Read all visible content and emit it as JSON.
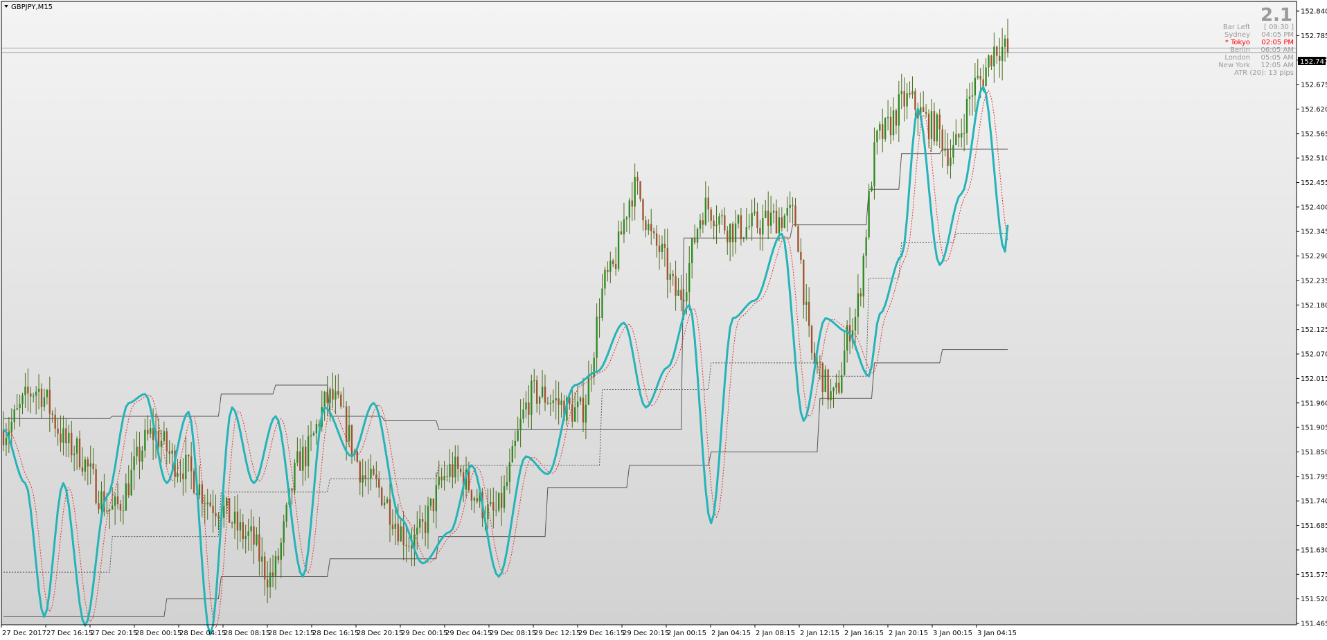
{
  "window_title": "GBPJPY,M15",
  "info_panel": {
    "big_number": "2.1",
    "rows": [
      {
        "label": "Bar Left",
        "value": "[ 09:30 ]",
        "highlight": false
      },
      {
        "label": "Sydney",
        "value": "04:05 PM",
        "highlight": false
      },
      {
        "label": "* Tokyo",
        "value": "02:05 PM",
        "highlight": true
      },
      {
        "label": "Berlin",
        "value": "06:05 AM",
        "highlight": false
      },
      {
        "label": "London",
        "value": "05:05 AM",
        "highlight": false
      },
      {
        "label": "New York",
        "value": "12:05 AM",
        "highlight": false
      }
    ],
    "atr": "ATR (20): 13 pips"
  },
  "price_label": "152.747",
  "colors": {
    "bull": "#2e8b22",
    "bear": "#a0522d",
    "osc": "#26b3b8",
    "signal": "#e03030",
    "level": "#555555",
    "highlight": "#ff0000"
  },
  "chart_data": {
    "type": "candlestick",
    "symbol": "GBPJPY",
    "timeframe": "M15",
    "ylim": [
      151.465,
      152.84
    ],
    "y_ticks": [
      "152.840",
      "152.785",
      "152.730",
      "152.675",
      "152.620",
      "152.565",
      "152.510",
      "152.455",
      "152.400",
      "152.345",
      "152.290",
      "152.235",
      "152.180",
      "152.125",
      "152.070",
      "152.015",
      "151.960",
      "151.905",
      "151.850",
      "151.795",
      "151.740",
      "151.685",
      "151.630",
      "151.575",
      "151.520",
      "151.465"
    ],
    "x_ticks": [
      "27 Dec 2017",
      "27 Dec 16:15",
      "27 Dec 20:15",
      "28 Dec 00:15",
      "28 Dec 04:15",
      "28 Dec 08:15",
      "28 Dec 12:15",
      "28 Dec 16:15",
      "28 Dec 20:15",
      "29 Dec 00:15",
      "29 Dec 04:15",
      "29 Dec 08:15",
      "29 Dec 12:15",
      "29 Dec 16:15",
      "29 Dec 20:15",
      "2 Jan 00:15",
      "2 Jan 04:15",
      "2 Jan 08:15",
      "2 Jan 12:15",
      "2 Jan 16:15",
      "2 Jan 20:15",
      "3 Jan 00:15",
      "3 Jan 04:15"
    ],
    "bar_count": 370,
    "current_price": 152.747,
    "horizontal_lines": [
      152.757,
      152.747
    ],
    "price_path": [
      [
        0,
        151.9
      ],
      [
        12,
        151.99
      ],
      [
        25,
        151.86
      ],
      [
        40,
        151.72
      ],
      [
        55,
        151.89
      ],
      [
        65,
        151.82
      ],
      [
        78,
        151.73
      ],
      [
        90,
        151.66
      ],
      [
        98,
        151.57
      ],
      [
        110,
        151.84
      ],
      [
        120,
        151.97
      ],
      [
        135,
        151.78
      ],
      [
        150,
        151.65
      ],
      [
        165,
        151.81
      ],
      [
        180,
        151.71
      ],
      [
        195,
        151.98
      ],
      [
        212,
        151.94
      ],
      [
        222,
        152.24
      ],
      [
        232,
        152.44
      ],
      [
        240,
        152.31
      ],
      [
        248,
        152.2
      ],
      [
        258,
        152.4
      ],
      [
        268,
        152.35
      ],
      [
        290,
        152.38
      ],
      [
        298,
        152.05
      ],
      [
        305,
        151.97
      ],
      [
        312,
        152.14
      ],
      [
        322,
        152.56
      ],
      [
        332,
        152.64
      ],
      [
        342,
        152.58
      ],
      [
        348,
        152.52
      ],
      [
        358,
        152.68
      ],
      [
        365,
        152.76
      ],
      [
        370,
        152.75
      ]
    ],
    "oscillator_path": [
      [
        0,
        151.9
      ],
      [
        8,
        151.78
      ],
      [
        15,
        151.48
      ],
      [
        22,
        151.78
      ],
      [
        30,
        151.46
      ],
      [
        38,
        151.75
      ],
      [
        46,
        151.96
      ],
      [
        52,
        151.98
      ],
      [
        60,
        151.78
      ],
      [
        68,
        151.94
      ],
      [
        76,
        151.44
      ],
      [
        84,
        151.95
      ],
      [
        92,
        151.78
      ],
      [
        100,
        151.93
      ],
      [
        110,
        151.57
      ],
      [
        118,
        151.95
      ],
      [
        128,
        151.84
      ],
      [
        136,
        151.96
      ],
      [
        146,
        151.7
      ],
      [
        154,
        151.6
      ],
      [
        164,
        151.67
      ],
      [
        172,
        151.82
      ],
      [
        182,
        151.57
      ],
      [
        192,
        151.84
      ],
      [
        200,
        151.8
      ],
      [
        210,
        152.0
      ],
      [
        218,
        152.03
      ],
      [
        228,
        152.14
      ],
      [
        236,
        151.95
      ],
      [
        244,
        152.04
      ],
      [
        252,
        152.18
      ],
      [
        260,
        151.69
      ],
      [
        268,
        152.15
      ],
      [
        276,
        152.19
      ],
      [
        286,
        152.34
      ],
      [
        294,
        151.92
      ],
      [
        302,
        152.15
      ],
      [
        310,
        152.12
      ],
      [
        318,
        152.02
      ],
      [
        322,
        152.16
      ],
      [
        330,
        152.29
      ],
      [
        336,
        152.62
      ],
      [
        344,
        152.27
      ],
      [
        352,
        152.43
      ],
      [
        360,
        152.67
      ],
      [
        368,
        152.3
      ],
      [
        370,
        152.42
      ]
    ],
    "levels": [
      {
        "style": "solid",
        "steps": [
          [
            0,
            151.925
          ],
          [
            40,
            151.93
          ],
          [
            80,
            151.98
          ],
          [
            100,
            152.0
          ],
          [
            120,
            151.93
          ],
          [
            140,
            151.92
          ],
          [
            160,
            151.9
          ],
          [
            190,
            151.9
          ],
          [
            250,
            152.33
          ],
          [
            290,
            152.36
          ],
          [
            318,
            152.44
          ],
          [
            330,
            152.52
          ],
          [
            345,
            152.53
          ],
          [
            370,
            152.62
          ]
        ]
      },
      {
        "style": "dashed",
        "steps": [
          [
            0,
            151.58
          ],
          [
            40,
            151.66
          ],
          [
            80,
            151.76
          ],
          [
            120,
            151.79
          ],
          [
            160,
            151.82
          ],
          [
            190,
            151.82
          ],
          [
            220,
            151.99
          ],
          [
            260,
            152.05
          ],
          [
            300,
            152.02
          ],
          [
            318,
            152.24
          ],
          [
            330,
            152.32
          ],
          [
            350,
            152.34
          ],
          [
            370,
            152.35
          ]
        ]
      },
      {
        "style": "solid",
        "steps": [
          [
            0,
            151.48
          ],
          [
            60,
            151.52
          ],
          [
            80,
            151.57
          ],
          [
            120,
            151.61
          ],
          [
            160,
            151.66
          ],
          [
            200,
            151.77
          ],
          [
            230,
            151.82
          ],
          [
            260,
            151.85
          ],
          [
            300,
            151.97
          ],
          [
            320,
            152.05
          ],
          [
            345,
            152.08
          ],
          [
            370,
            152.09
          ]
        ]
      }
    ]
  }
}
